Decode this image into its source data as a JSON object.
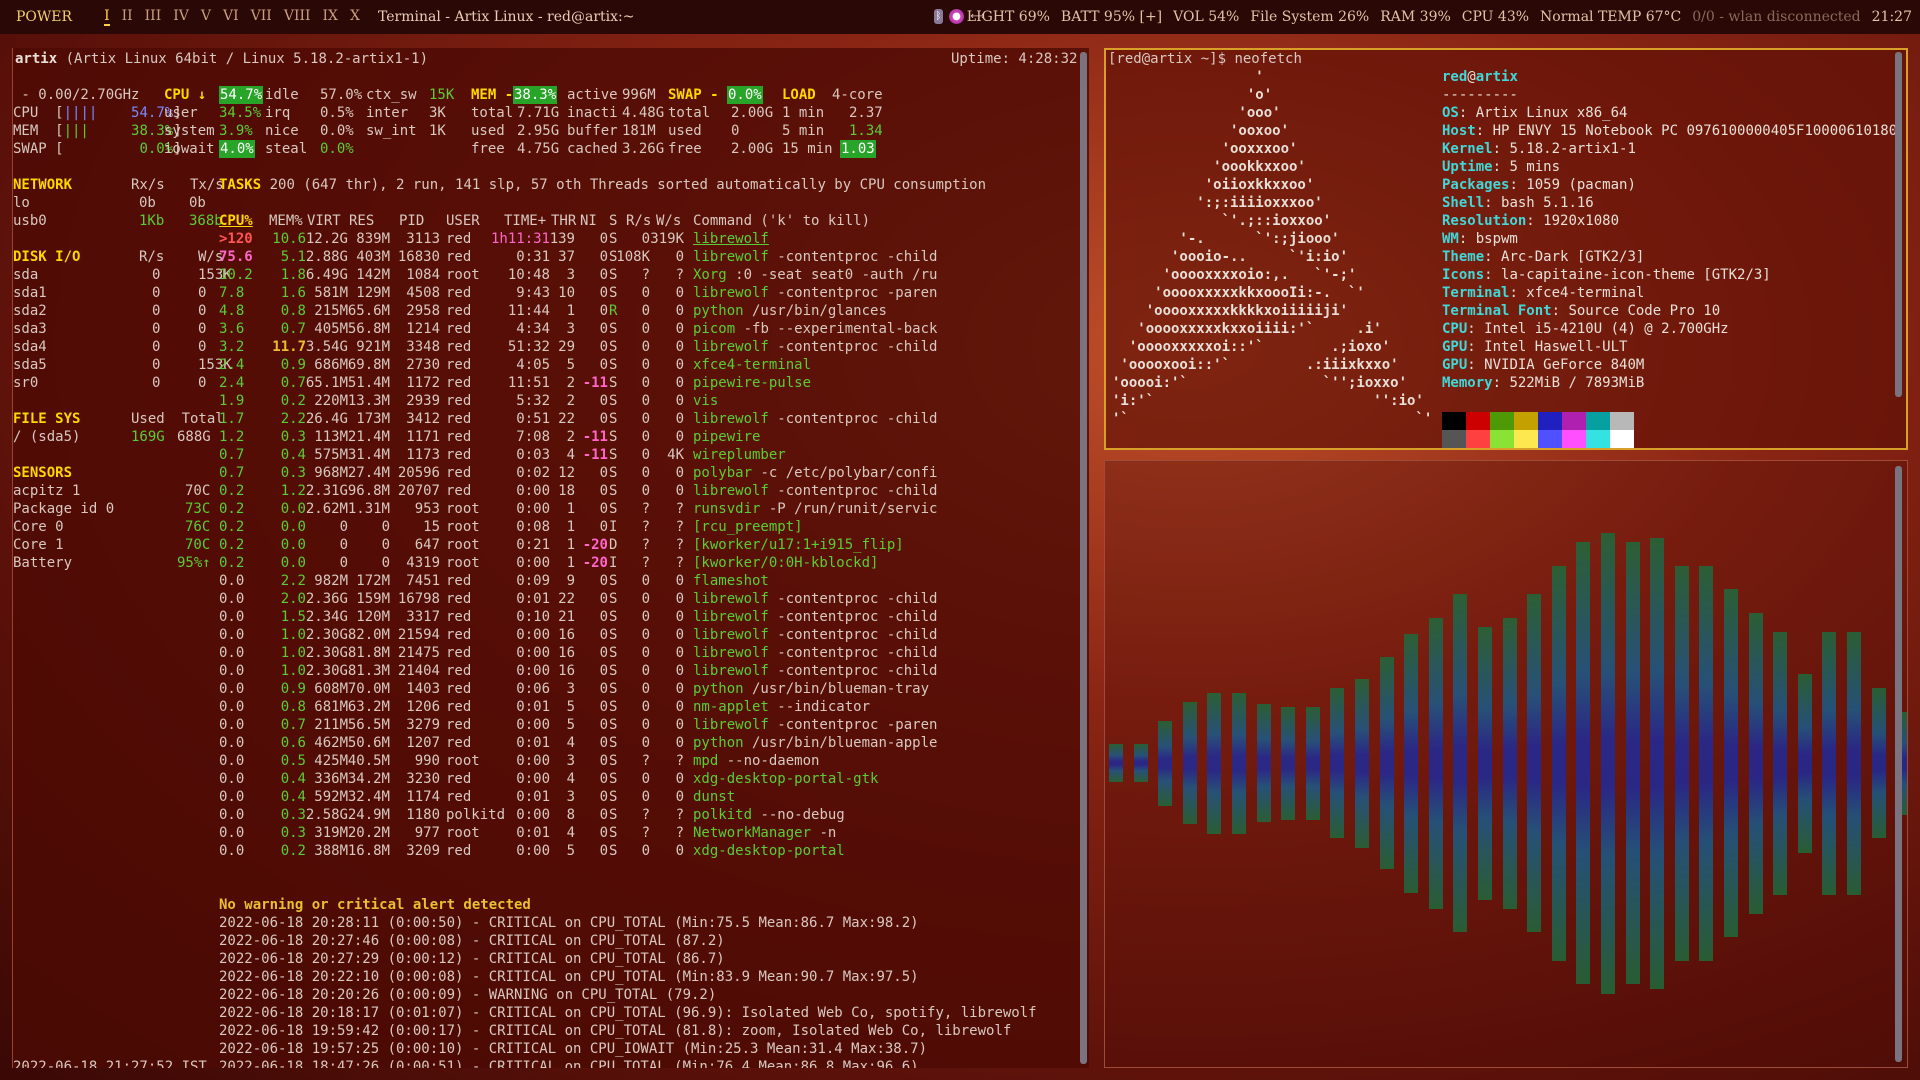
{
  "topbar": {
    "power": "POWER",
    "workspaces": [
      "I",
      "II",
      "III",
      "IV",
      "V",
      "VI",
      "VII",
      "VIII",
      "IX",
      "X"
    ],
    "title": "Terminal - Artix Linux - red@artix:~",
    "tray_icons": [
      "bluetooth-icon",
      "firefox-icon",
      "link-icon"
    ],
    "stats": {
      "light": "LIGHT 69%",
      "batt": "BATT 95% [+]",
      "vol": "VOL 54%",
      "fs": "File System 26%",
      "ram": "RAM 39%",
      "cpu": "CPU 43%",
      "temp": "Normal TEMP 67°C",
      "wlan": "0/0 - wlan disconnected",
      "clock": "21:27"
    }
  },
  "glances": {
    "host": "artix",
    "sysinfo": "(Artix Linux 64bit / Linux 5.18.2-artix1-1)",
    "uptime": "Uptime: 4:28:32",
    "quicklook": {
      "freq": " - 0.00/2.70GHz",
      "cpu": "CPU  [||||    54.7%]",
      "mem": "MEM  [|||     38.3%]",
      "swap": "SWAP [         0.0%]"
    },
    "cpu": {
      "hdr": "CPU ↓",
      "pct": "54.7%",
      "rows": [
        [
          "user",
          "34.5%"
        ],
        [
          "system",
          "3.9%"
        ],
        [
          "iowait",
          "4.0%"
        ]
      ],
      "rows2": [
        [
          "idle",
          "57.0%"
        ],
        [
          "irq",
          "0.5%"
        ],
        [
          "nice",
          "0.0%"
        ],
        [
          "steal",
          "0.0%"
        ]
      ],
      "rows3": [
        [
          "ctx_sw",
          "15K"
        ],
        [
          "inter",
          "3K"
        ],
        [
          "sw_int",
          "1K"
        ]
      ]
    },
    "mem": {
      "hdr": "MEM -",
      "pct": "38.3%",
      "rows": [
        [
          "total",
          "7.71G"
        ],
        [
          "used",
          "2.95G"
        ],
        [
          "free",
          "4.75G"
        ]
      ],
      "rows2": [
        [
          "active",
          "996M"
        ],
        [
          "inacti",
          "4.48G"
        ],
        [
          "buffer",
          "181M"
        ],
        [
          "cached",
          "3.26G"
        ]
      ]
    },
    "swap": {
      "hdr": "SWAP -",
      "pct": "0.0%",
      "rows": [
        [
          "total",
          "2.00G"
        ],
        [
          "used",
          "0"
        ],
        [
          "free",
          "2.00G"
        ]
      ]
    },
    "load": {
      "hdr": "LOAD",
      "cores": "4-core",
      "rows": [
        [
          "1 min",
          "2.37"
        ],
        [
          "5 min",
          "1.34"
        ],
        [
          "15 min",
          "1.03"
        ]
      ]
    },
    "network": {
      "hdr": "NETWORK",
      "cols": "Rx/s   Tx/s",
      "rows": [
        [
          "lo",
          "0b",
          "0b"
        ],
        [
          "usb0",
          "1Kb",
          "368b"
        ]
      ]
    },
    "disk": {
      "hdr": "DISK I/O",
      "cols": "R/s    W/s",
      "rows": [
        [
          "sda",
          "0",
          "153K"
        ],
        [
          "sda1",
          "0",
          "0"
        ],
        [
          "sda2",
          "0",
          "0"
        ],
        [
          "sda3",
          "0",
          "0"
        ],
        [
          "sda4",
          "0",
          "0"
        ],
        [
          "sda5",
          "0",
          "153K"
        ],
        [
          "sr0",
          "0",
          "0"
        ]
      ]
    },
    "fs": {
      "hdr": "FILE SYS",
      "cols": "Used  Total",
      "rows": [
        [
          "/ (sda5)",
          "169G",
          "688G"
        ]
      ]
    },
    "sensors": {
      "hdr": "SENSORS",
      "rows": [
        [
          "acpitz 1",
          "70C"
        ],
        [
          "Package id 0",
          "73C"
        ],
        [
          "Core 0",
          "76C"
        ],
        [
          "Core 1",
          "70C"
        ],
        [
          "Battery",
          "95%↑"
        ]
      ]
    },
    "tasks": "TASKS 200 (647 thr), 2 run, 141 slp, 57 oth Threads sorted automatically by CPU consumption",
    "proc_header": [
      "CPU%",
      "MEM%",
      "VIRT",
      "RES",
      "PID",
      "USER",
      "TIME+",
      "THR",
      "NI",
      "S",
      "R/s",
      "W/s",
      "Command ('k' to kill)"
    ],
    "processes": [
      [
        ">120",
        "10.6",
        "12.2G",
        "839M",
        "3113",
        "red",
        "1h11:31",
        "139",
        "0",
        "S",
        "0",
        "319K",
        "librewolf",
        ""
      ],
      [
        "75.6",
        "5.1",
        "2.88G",
        "403M",
        "16830",
        "red",
        "0:31",
        "37",
        "0",
        "S",
        "108K",
        "0",
        "librewolf",
        "-contentproc -child"
      ],
      [
        "10.2",
        "1.8",
        "6.49G",
        "142M",
        "1084",
        "root",
        "10:48",
        "3",
        "0",
        "S",
        "?",
        "?",
        "Xorg",
        ":0 -seat seat0 -auth /ru"
      ],
      [
        "7.8",
        "1.6",
        "581M",
        "129M",
        "4508",
        "red",
        "9:43",
        "10",
        "0",
        "S",
        "0",
        "0",
        "librewolf",
        "-contentproc -paren"
      ],
      [
        "4.8",
        "0.8",
        "215M",
        "65.6M",
        "2958",
        "red",
        "11:44",
        "1",
        "0",
        "R",
        "0",
        "0",
        "python",
        "/usr/bin/glances"
      ],
      [
        "3.6",
        "0.7",
        "405M",
        "56.8M",
        "1214",
        "red",
        "4:34",
        "3",
        "0",
        "S",
        "0",
        "0",
        "picom",
        "-fb --experimental-back"
      ],
      [
        "3.2",
        "11.7",
        "3.54G",
        "921M",
        "3348",
        "red",
        "51:32",
        "29",
        "0",
        "S",
        "0",
        "0",
        "librewolf",
        "-contentproc -child"
      ],
      [
        "2.4",
        "0.9",
        "686M",
        "69.8M",
        "2730",
        "red",
        "4:05",
        "5",
        "0",
        "S",
        "0",
        "0",
        "xfce4-terminal",
        ""
      ],
      [
        "2.4",
        "0.7",
        "65.1M",
        "51.4M",
        "1172",
        "red",
        "11:51",
        "2",
        "-11",
        "S",
        "0",
        "0",
        "pipewire-pulse",
        ""
      ],
      [
        "1.9",
        "0.2",
        "220M",
        "13.3M",
        "2939",
        "red",
        "5:32",
        "2",
        "0",
        "S",
        "0",
        "0",
        "vis",
        ""
      ],
      [
        "1.7",
        "2.2",
        "26.4G",
        "173M",
        "3412",
        "red",
        "0:51",
        "22",
        "0",
        "S",
        "0",
        "0",
        "librewolf",
        "-contentproc -child"
      ],
      [
        "1.2",
        "0.3",
        "113M",
        "21.4M",
        "1171",
        "red",
        "7:08",
        "2",
        "-11",
        "S",
        "0",
        "0",
        "pipewire",
        ""
      ],
      [
        "0.7",
        "0.4",
        "575M",
        "31.4M",
        "1173",
        "red",
        "0:03",
        "4",
        "-11",
        "S",
        "0",
        "4K",
        "wireplumber",
        ""
      ],
      [
        "0.7",
        "0.3",
        "968M",
        "27.4M",
        "20596",
        "red",
        "0:02",
        "12",
        "0",
        "S",
        "0",
        "0",
        "polybar",
        "-c /etc/polybar/confi"
      ],
      [
        "0.2",
        "1.2",
        "2.31G",
        "96.8M",
        "20707",
        "red",
        "0:00",
        "18",
        "0",
        "S",
        "0",
        "0",
        "librewolf",
        "-contentproc -child"
      ],
      [
        "0.2",
        "0.0",
        "2.62M",
        "1.31M",
        "953",
        "root",
        "0:00",
        "1",
        "0",
        "S",
        "?",
        "?",
        "runsvdir",
        "-P /run/runit/servic"
      ],
      [
        "0.2",
        "0.0",
        "0",
        "0",
        "15",
        "root",
        "0:08",
        "1",
        "0",
        "I",
        "?",
        "?",
        "[rcu_preempt]",
        ""
      ],
      [
        "0.2",
        "0.0",
        "0",
        "0",
        "647",
        "root",
        "0:21",
        "1",
        "-20",
        "D",
        "?",
        "?",
        "[kworker/u17:1+i915_flip]",
        ""
      ],
      [
        "0.2",
        "0.0",
        "0",
        "0",
        "4319",
        "root",
        "0:00",
        "1",
        "-20",
        "I",
        "?",
        "?",
        "[kworker/0:0H-kblockd]",
        ""
      ],
      [
        "0.0",
        "2.2",
        "982M",
        "172M",
        "7451",
        "red",
        "0:09",
        "9",
        "0",
        "S",
        "0",
        "0",
        "flameshot",
        ""
      ],
      [
        "0.0",
        "2.0",
        "2.36G",
        "159M",
        "16798",
        "red",
        "0:01",
        "22",
        "0",
        "S",
        "0",
        "0",
        "librewolf",
        "-contentproc -child"
      ],
      [
        "0.0",
        "1.5",
        "2.34G",
        "120M",
        "3317",
        "red",
        "0:10",
        "21",
        "0",
        "S",
        "0",
        "0",
        "librewolf",
        "-contentproc -child"
      ],
      [
        "0.0",
        "1.0",
        "2.30G",
        "82.0M",
        "21594",
        "red",
        "0:00",
        "16",
        "0",
        "S",
        "0",
        "0",
        "librewolf",
        "-contentproc -child"
      ],
      [
        "0.0",
        "1.0",
        "2.30G",
        "81.8M",
        "21475",
        "red",
        "0:00",
        "16",
        "0",
        "S",
        "0",
        "0",
        "librewolf",
        "-contentproc -child"
      ],
      [
        "0.0",
        "1.0",
        "2.30G",
        "81.3M",
        "21404",
        "red",
        "0:00",
        "16",
        "0",
        "S",
        "0",
        "0",
        "librewolf",
        "-contentproc -child"
      ],
      [
        "0.0",
        "0.9",
        "608M",
        "70.0M",
        "1403",
        "red",
        "0:06",
        "3",
        "0",
        "S",
        "0",
        "0",
        "python",
        "/usr/bin/blueman-tray"
      ],
      [
        "0.0",
        "0.8",
        "681M",
        "63.2M",
        "1206",
        "red",
        "0:01",
        "5",
        "0",
        "S",
        "0",
        "0",
        "nm-applet",
        "--indicator"
      ],
      [
        "0.0",
        "0.7",
        "211M",
        "56.5M",
        "3279",
        "red",
        "0:00",
        "5",
        "0",
        "S",
        "0",
        "0",
        "librewolf",
        "-contentproc -paren"
      ],
      [
        "0.0",
        "0.6",
        "462M",
        "50.6M",
        "1207",
        "red",
        "0:01",
        "4",
        "0",
        "S",
        "0",
        "0",
        "python",
        "/usr/bin/blueman-apple"
      ],
      [
        "0.0",
        "0.5",
        "425M",
        "40.5M",
        "990",
        "root",
        "0:00",
        "3",
        "0",
        "S",
        "?",
        "?",
        "mpd",
        "--no-daemon"
      ],
      [
        "0.0",
        "0.4",
        "336M",
        "34.2M",
        "3230",
        "red",
        "0:00",
        "4",
        "0",
        "S",
        "0",
        "0",
        "xdg-desktop-portal-gtk",
        ""
      ],
      [
        "0.0",
        "0.4",
        "592M",
        "32.4M",
        "1174",
        "red",
        "0:01",
        "3",
        "0",
        "S",
        "0",
        "0",
        "dunst",
        ""
      ],
      [
        "0.0",
        "0.3",
        "2.58G",
        "24.9M",
        "1180",
        "polkitd",
        "0:00",
        "8",
        "0",
        "S",
        "?",
        "?",
        "polkitd",
        "--no-debug"
      ],
      [
        "0.0",
        "0.3",
        "319M",
        "20.2M",
        "977",
        "root",
        "0:01",
        "4",
        "0",
        "S",
        "?",
        "?",
        "NetworkManager",
        "-n"
      ],
      [
        "0.0",
        "0.2",
        "388M",
        "16.8M",
        "3209",
        "red",
        "0:00",
        "5",
        "0",
        "S",
        "0",
        "0",
        "xdg-desktop-portal",
        ""
      ]
    ],
    "alert_title": "No warning or critical alert detected",
    "alerts": [
      "2022-06-18 20:28:11 (0:00:50) - CRITICAL on CPU_TOTAL (Min:75.5 Mean:86.7 Max:98.2)",
      "2022-06-18 20:27:46 (0:00:08) - CRITICAL on CPU_TOTAL (87.2)",
      "2022-06-18 20:27:29 (0:00:12) - CRITICAL on CPU_TOTAL (86.7)",
      "2022-06-18 20:22:10 (0:00:08) - CRITICAL on CPU_TOTAL (Min:83.9 Mean:90.7 Max:97.5)",
      "2022-06-18 20:20:26 (0:00:09) - WARNING on CPU_TOTAL (79.2)",
      "2022-06-18 20:18:17 (0:01:07) - CRITICAL on CPU_TOTAL (96.9): Isolated Web Co, spotify, librewolf",
      "2022-06-18 19:59:42 (0:00:17) - CRITICAL on CPU_TOTAL (81.8): zoom, Isolated Web Co, librewolf",
      "2022-06-18 19:57:25 (0:00:10) - CRITICAL on CPU_IOWAIT (Min:25.3 Mean:31.4 Max:38.7)",
      "2022-06-18 18:47:26 (0:00:51) - CRITICAL on CPU_TOTAL (Min:76.4 Mean:86.8 Max:96.6)"
    ],
    "clock": "2022-06-18 21:27:52 IST"
  },
  "neofetch": {
    "prompt": "[red@artix ~]$ ",
    "command": "neofetch",
    "logo": [
      "                 '",
      "                'o'",
      "               'ooo'",
      "              'ooxoo'",
      "             'ooxxxoo'",
      "            'oookkxxoo'",
      "           'oiioxkkxxoo'",
      "          ':;:iiiioxxxoo'",
      "             `'.;::ioxxoo'",
      "        '-.      `':;jiooo'",
      "       'oooio-..     `'i:io'",
      "      'ooooxxxxoio:,.   `'-;'",
      "     'ooooxxxxxkkxoooIi:-.  `'",
      "    'ooooxxxxxkkkkxoiiiiiji'",
      "   'ooooxxxxxkxxoiiii:'`     .i'",
      "  'ooooxxxxxoi::'`        .;ioxo'",
      " 'ooooxooi::'`         .:iiixkxxo'",
      "'ooooi:'`                `'';ioxxo'",
      "'i:'`                          '':io'",
      "'`                                  `'"
    ],
    "user": "red",
    "host": "artix",
    "sep": "---------",
    "info": [
      [
        "OS",
        "Artix Linux x86_64"
      ],
      [
        "Host",
        "HP ENVY 15 Notebook PC 0976100000405F10000610180"
      ],
      [
        "Kernel",
        "5.18.2-artix1-1"
      ],
      [
        "Uptime",
        "5 mins"
      ],
      [
        "Packages",
        "1059 (pacman)"
      ],
      [
        "Shell",
        "bash 5.1.16"
      ],
      [
        "Resolution",
        "1920x1080"
      ],
      [
        "WM",
        "bspwm"
      ],
      [
        "Theme",
        "Arc-Dark [GTK2/3]"
      ],
      [
        "Icons",
        "la-capitaine-icon-theme [GTK2/3]"
      ],
      [
        "Terminal",
        "xfce4-terminal"
      ],
      [
        "Terminal Font",
        "Source Code Pro 10"
      ],
      [
        "CPU",
        "Intel i5-4210U (4) @ 2.700GHz"
      ],
      [
        "GPU",
        "Intel Haswell-ULT"
      ],
      [
        "GPU",
        "NVIDIA GeForce 840M"
      ],
      [
        "Memory",
        "522MiB / 7893MiB"
      ]
    ],
    "palette_top": [
      "#000000",
      "#cc0000",
      "#4e9a06",
      "#c4a000",
      "#2020c0",
      "#b020b0",
      "#06a0a0",
      "#b8b8b8"
    ],
    "palette_bottom": [
      "#555555",
      "#ff4040",
      "#8ae234",
      "#fce94f",
      "#5050ff",
      "#ff50ff",
      "#34e2e2",
      "#ffffff"
    ]
  },
  "visualizer": {
    "levels": [
      0.08,
      0.08,
      0.18,
      0.26,
      0.3,
      0.3,
      0.25,
      0.24,
      0.24,
      0.32,
      0.36,
      0.45,
      0.55,
      0.62,
      0.72,
      0.58,
      0.62,
      0.72,
      0.84,
      0.94,
      0.98,
      0.94,
      0.96,
      0.84,
      0.84,
      0.74,
      0.64,
      0.56,
      0.38,
      0.56,
      0.56,
      0.32,
      0.22,
      0.12,
      0.08,
      0.08,
      0.08
    ],
    "colors": {
      "low": "#1f2a9a",
      "mid": "#1a5a8a",
      "high": "#1f6a3a"
    }
  }
}
